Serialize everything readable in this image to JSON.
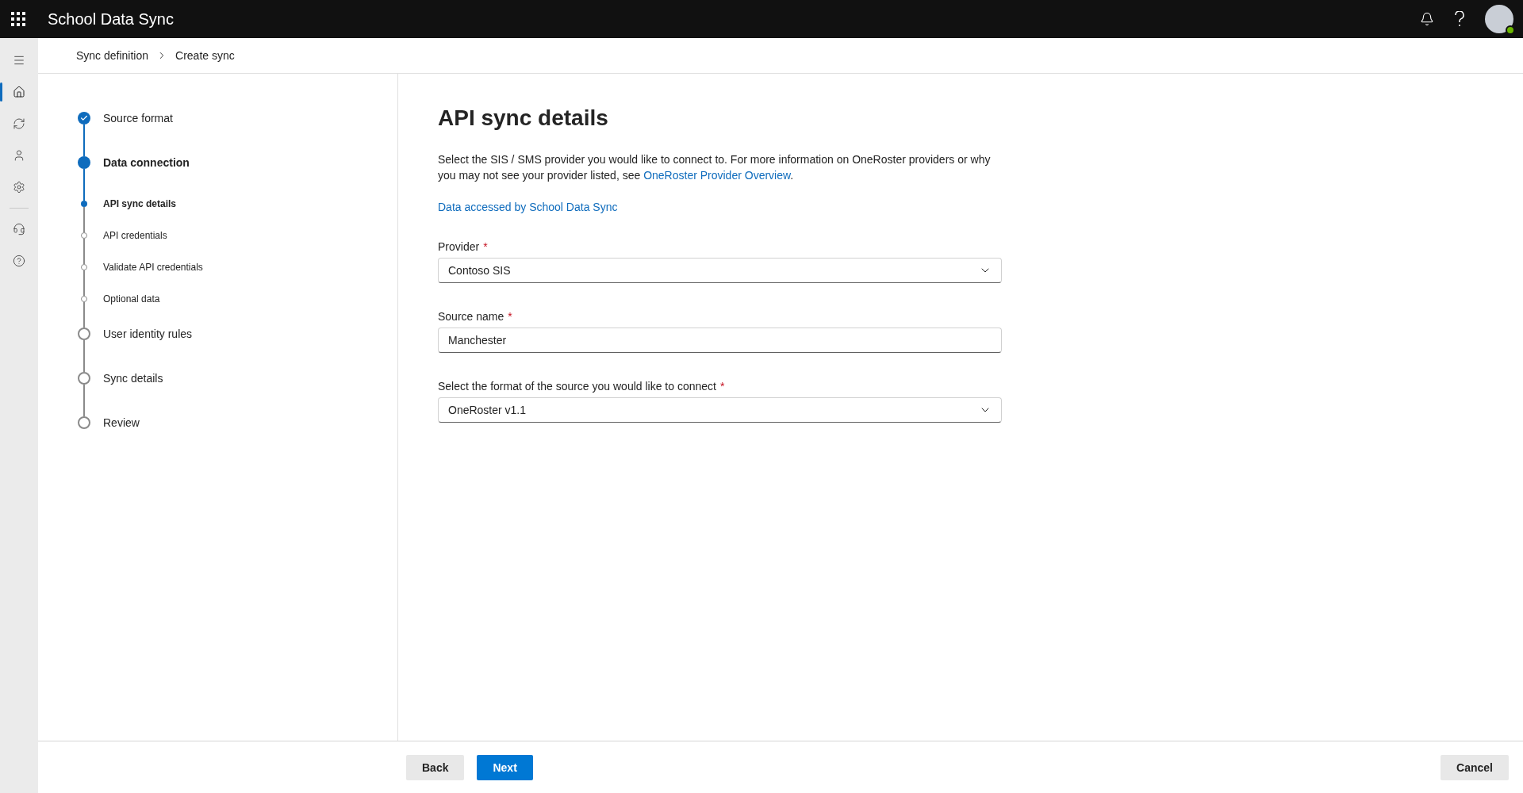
{
  "header": {
    "app_title": "School Data Sync",
    "avatar": {
      "online": true
    }
  },
  "rail": {
    "items": [
      {
        "selected": true
      },
      {
        "selected": false
      },
      {
        "selected": false
      },
      {
        "selected": false
      },
      {
        "selected": false
      },
      {
        "selected": false
      }
    ]
  },
  "breadcrumb": [
    "Sync definition",
    "Create sync"
  ],
  "steps": [
    {
      "label": "Source format",
      "completed": true,
      "selected": false
    },
    {
      "label": "Data connection",
      "completed": false,
      "selected": true,
      "children": [
        {
          "label": "API sync details",
          "completed": false,
          "selected": true
        },
        {
          "label": "API credentials",
          "completed": false,
          "selected": false
        },
        {
          "label": "Validate API credentials",
          "completed": false,
          "selected": false
        },
        {
          "label": "Optional data",
          "completed": false,
          "selected": false
        }
      ]
    },
    {
      "label": "User identity rules",
      "completed": false,
      "selected": false
    },
    {
      "label": "Sync details",
      "completed": false,
      "selected": false
    },
    {
      "label": "Review",
      "completed": false,
      "selected": false
    }
  ],
  "main": {
    "title": "API sync details",
    "description": {
      "text_before": "Select the SIS / SMS provider you would like to connect to. For more information on OneRoster providers or why you may not see your provider listed, see ",
      "link": "OneRoster Provider Overview",
      "text_after": "."
    },
    "data_link": "Data accessed by School Data Sync",
    "fields": [
      {
        "kind": "dropdown",
        "label": "Provider",
        "required_mark": "*",
        "value": "Contoso SIS"
      },
      {
        "kind": "text",
        "label": "Source name",
        "required_mark": "*",
        "value": "Manchester"
      },
      {
        "kind": "dropdown",
        "label": "Select the format of the source you would like to connect",
        "required_mark": "*",
        "value": "OneRoster v1.1"
      }
    ]
  },
  "footer": {
    "buttons": [
      {
        "label": "Back",
        "kind": "secondary"
      },
      {
        "label": "Next",
        "kind": "primary"
      }
    ],
    "cancel": "Cancel"
  }
}
